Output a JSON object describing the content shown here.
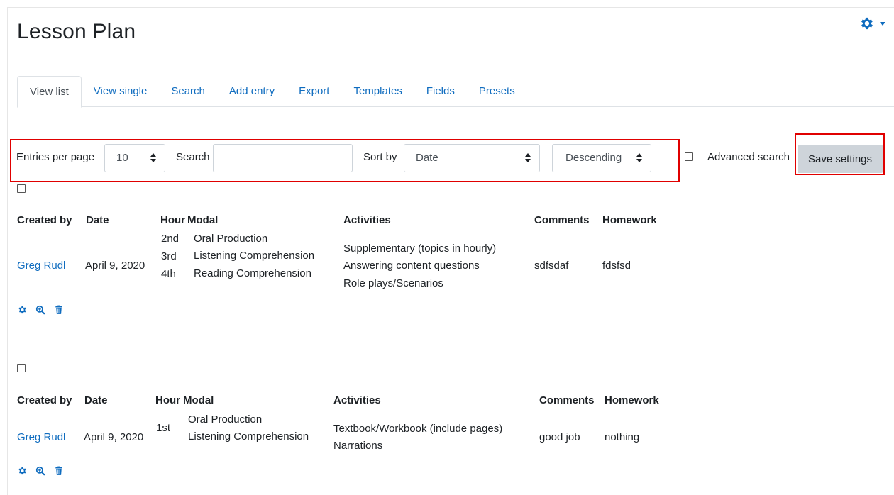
{
  "page": {
    "title": "Lesson Plan"
  },
  "tabs": [
    {
      "label": "View list",
      "active": true
    },
    {
      "label": "View single"
    },
    {
      "label": "Search"
    },
    {
      "label": "Add entry"
    },
    {
      "label": "Export"
    },
    {
      "label": "Templates"
    },
    {
      "label": "Fields"
    },
    {
      "label": "Presets"
    }
  ],
  "filters": {
    "entries_label": "Entries per page",
    "entries_value": "10",
    "search_label": "Search",
    "search_value": "",
    "sort_label": "Sort by",
    "sort_value": "Date",
    "order_value": "Descending",
    "advanced_label": "Advanced search",
    "advanced_checked": false,
    "save_label": "Save settings"
  },
  "columns": {
    "created_by": "Created by",
    "date": "Date",
    "hour": "Hour",
    "modal": "Modal",
    "activities": "Activities",
    "comments": "Comments",
    "homework": "Homework"
  },
  "entries": [
    {
      "created_by": "Greg Rudl",
      "date": "April 9, 2020",
      "hours": [
        "2nd",
        "3rd",
        "4th"
      ],
      "modals": [
        "Oral Production",
        "Listening Comprehension",
        "Reading Comprehension"
      ],
      "activities": [
        "Supplementary (topics in hourly)",
        "Answering content questions",
        "Role plays/Scenarios"
      ],
      "comments": "sdfsdaf",
      "homework": "fdsfsd"
    },
    {
      "created_by": "Greg Rudl",
      "date": "April 9, 2020",
      "hours": [
        "1st"
      ],
      "modals": [
        "Oral Production",
        "Listening Comprehension"
      ],
      "activities": [
        "Textbook/Workbook (include pages)",
        "Narrations"
      ],
      "comments": "good job",
      "homework": "nothing"
    }
  ],
  "icons": {
    "gear": "gear-icon",
    "edit": "gear-icon",
    "view": "zoom-in-icon",
    "delete": "trash-icon"
  },
  "colors": {
    "link": "#0f6cbf",
    "highlight": "#e00000",
    "button_bg": "#ced4da"
  }
}
